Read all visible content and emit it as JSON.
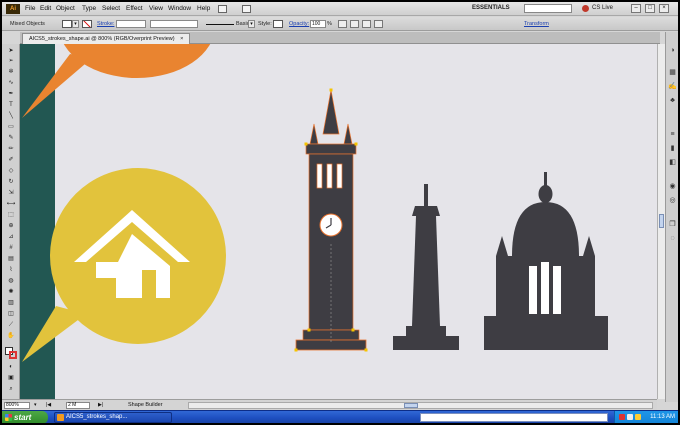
{
  "menubar": {
    "app_logo": "Ai",
    "items": [
      "File",
      "Edit",
      "Object",
      "Type",
      "Select",
      "Effect",
      "View",
      "Window",
      "Help"
    ],
    "workspace": "ESSENTIALS",
    "cs_live": "CS Live",
    "window_controls": [
      "–",
      "□",
      "×"
    ]
  },
  "controlbar": {
    "selection": "Mixed Objects",
    "stroke_label": "Stroke:",
    "brush_label": "Basic",
    "style_label": "Style:",
    "opacity_label": "Opacity:",
    "opacity_value": "100",
    "opacity_unit": "%",
    "transform_label": "Transform"
  },
  "document": {
    "tab_title": "AICS5_strokes_shape.ai @ 800% (RGB/Overprint Preview)",
    "tab_close": "×"
  },
  "statusbar": {
    "zoom": "800%",
    "page": "2 M",
    "tool_mode": "Shape Builder"
  },
  "taskbar": {
    "start": "start",
    "task_item": "AICS5_strokes_shap...",
    "clock": "11:13 AM"
  },
  "colors": {
    "canvas_bg": "#e5e4e9",
    "teal_panel": "#225752",
    "orange_bubble": "#e98430",
    "yellow_bubble": "#e2c33c",
    "building": "#3e3d43",
    "selection_outline": "#e8732f",
    "anchor_point": "#f5c400"
  },
  "icons": {
    "tools": [
      "selection-icon",
      "direct-selection-icon",
      "magic-wand-icon",
      "lasso-icon",
      "pen-icon",
      "type-icon",
      "line-icon",
      "rectangle-icon",
      "paintbrush-icon",
      "pencil-icon",
      "blob-brush-icon",
      "eraser-icon",
      "rotate-icon",
      "scale-icon",
      "width-icon",
      "free-transform-icon",
      "shape-builder-icon",
      "perspective-grid-icon",
      "mesh-icon",
      "gradient-icon",
      "eyedropper-icon",
      "blend-icon",
      "symbol-sprayer-icon",
      "column-graph-icon",
      "artboard-icon",
      "slice-icon",
      "hand-icon",
      "zoom-icon"
    ],
    "dock": [
      "color-icon",
      "swatches-icon",
      "brushes-icon",
      "symbols-icon",
      "stroke-icon",
      "gradient-icon",
      "transparency-icon",
      "appearance-icon",
      "graphic-styles-icon",
      "layers-icon",
      "artboards-icon"
    ]
  }
}
